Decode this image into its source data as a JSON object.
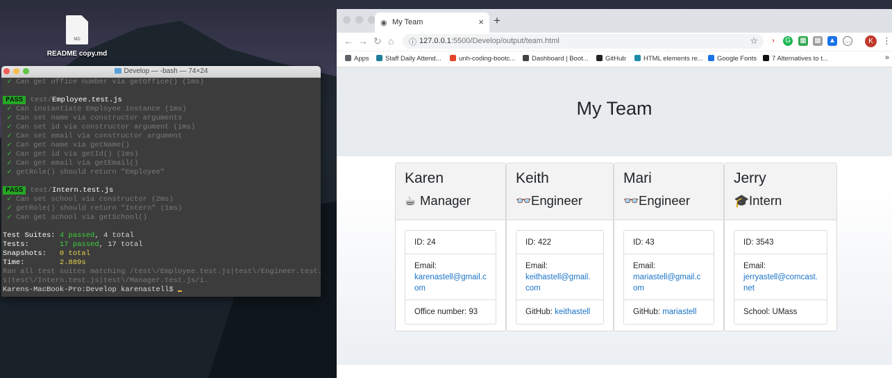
{
  "desktop": {
    "file_label": "README copy.md",
    "file_badge": "MD"
  },
  "terminal": {
    "title": "Develop — -bash — 74×24",
    "lines": [
      {
        "kind": "check",
        "text": "Can get office number via getOffice() (1ms)"
      },
      {
        "kind": "blank"
      },
      {
        "kind": "pass",
        "badge": "PASS",
        "dir": "test/",
        "file": "Employee.test.js"
      },
      {
        "kind": "check",
        "text": "Can instantiate Employee instance (1ms)"
      },
      {
        "kind": "check",
        "text": "Can set name via constructor arguments"
      },
      {
        "kind": "check",
        "text": "Can set id via constructor argument (1ms)"
      },
      {
        "kind": "check",
        "text": "Can set email via constructor argument"
      },
      {
        "kind": "check",
        "text": "Can get name via getName()"
      },
      {
        "kind": "check",
        "text": "Can get id via getId() (1ms)"
      },
      {
        "kind": "check",
        "text": "Can get email via getEmail()"
      },
      {
        "kind": "check",
        "text": "getRole() should return \"Employee\""
      },
      {
        "kind": "blank"
      },
      {
        "kind": "pass",
        "badge": "PASS",
        "dir": "test/",
        "file": "Intern.test.js"
      },
      {
        "kind": "check",
        "text": "Can set school via constructor (2ms)"
      },
      {
        "kind": "check",
        "text": "getRole() should return \"Intern\" (1ms)"
      },
      {
        "kind": "check",
        "text": "Can get school via getSchool()"
      },
      {
        "kind": "blank"
      },
      {
        "kind": "summary",
        "label": "Test Suites: ",
        "passed": "4 passed",
        "rest": ", 4 total"
      },
      {
        "kind": "summary",
        "label": "Tests:       ",
        "passed": "17 passed",
        "rest": ", 17 total"
      },
      {
        "kind": "plain",
        "label": "Snapshots:   ",
        "value": "0 total",
        "color": "yellow"
      },
      {
        "kind": "plain",
        "label": "Time:        ",
        "value": "2.889s",
        "color": "yellow"
      },
      {
        "kind": "dim",
        "text": "Ran all test suites matching /test\\/Employee.test.js|test\\/Engineer.test.j"
      },
      {
        "kind": "dim",
        "text": "s|test\\/Intern.test.js|test\\/Manager.test.js/i."
      },
      {
        "kind": "prompt",
        "text": "Karens-MacBook-Pro:Develop karenastell$ "
      }
    ]
  },
  "browser": {
    "tab_title": "My Team",
    "url_host": "127.0.0.1",
    "url_rest": ":5500/Develop/output/team.html",
    "profile_initial": "K",
    "bookmarks": [
      {
        "label": "Apps",
        "color": "#5f6368"
      },
      {
        "label": "Staff Daily Attend...",
        "color": "#1e7e9a"
      },
      {
        "label": "unh-coding-bootc...",
        "color": "#e24329"
      },
      {
        "label": "Dashboard | Boot...",
        "color": "#444444"
      },
      {
        "label": "GitHub",
        "color": "#222222"
      },
      {
        "label": "HTML elements re...",
        "color": "#1d8ca6"
      },
      {
        "label": "Google Fonts",
        "color": "#1a73e8"
      },
      {
        "label": "7 Alternatives to t...",
        "color": "#111111"
      }
    ]
  },
  "page": {
    "title": "My Team",
    "cards": [
      {
        "name": "Karen",
        "role": "Manager",
        "role_icon": "coffee-icon",
        "id": "ID: 24",
        "email_label": "Email:",
        "email": "karenastell@gmail.com",
        "last_label": "Office number: 93",
        "last_link": ""
      },
      {
        "name": "Keith",
        "role": "Engineer",
        "role_icon": "glasses-icon",
        "id": "ID: 422",
        "email_label": "Email:",
        "email": "keithastell@gmail.com",
        "last_label": "GitHub: ",
        "last_link": "keithastell"
      },
      {
        "name": "Mari",
        "role": "Engineer",
        "role_icon": "glasses-icon",
        "id": "ID: 43",
        "email_label": "Email:",
        "email": "mariastell@gmail.com",
        "last_label": "GitHub: ",
        "last_link": "mariastell"
      },
      {
        "name": "Jerry",
        "role": "Intern",
        "role_icon": "graduate-icon",
        "id": "ID: 3543",
        "email_label": "Email:",
        "email": "jerryastell@comcast.net",
        "last_label": "School: UMass",
        "last_link": ""
      }
    ]
  }
}
